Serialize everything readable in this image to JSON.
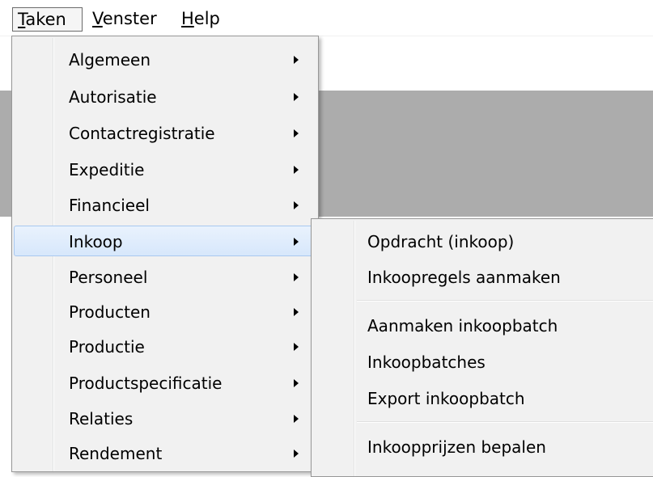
{
  "menubar": {
    "items": [
      {
        "mnemonic": "T",
        "rest": "aken"
      },
      {
        "mnemonic": "V",
        "rest": "enster"
      },
      {
        "mnemonic": "H",
        "rest": "elp"
      }
    ]
  },
  "taken_menu": {
    "items": [
      {
        "label": "Algemeen"
      },
      {
        "label": "Autorisatie"
      },
      {
        "label": "Contactregistratie"
      },
      {
        "label": "Expeditie"
      },
      {
        "label": "Financieel"
      },
      {
        "label": "Inkoop"
      },
      {
        "label": "Personeel"
      },
      {
        "label": "Producten"
      },
      {
        "label": "Productie"
      },
      {
        "label": "Productspecificatie"
      },
      {
        "label": "Relaties"
      },
      {
        "label": "Rendement"
      }
    ],
    "highlighted": "Inkoop"
  },
  "inkoop_submenu": {
    "items": [
      {
        "label": "Opdracht (inkoop)"
      },
      {
        "label": "Inkoopregels aanmaken"
      },
      {
        "label": "Aanmaken inkoopbatch"
      },
      {
        "label": "Inkoopbatches"
      },
      {
        "label": "Export inkoopbatch"
      },
      {
        "label": "Inkoopprijzen bepalen"
      }
    ]
  },
  "colors": {
    "menu_background": "#f1f1f1",
    "highlight": "#d7e7fb",
    "highlight_border": "#a8c8f0",
    "window_gray": "#acacac"
  }
}
